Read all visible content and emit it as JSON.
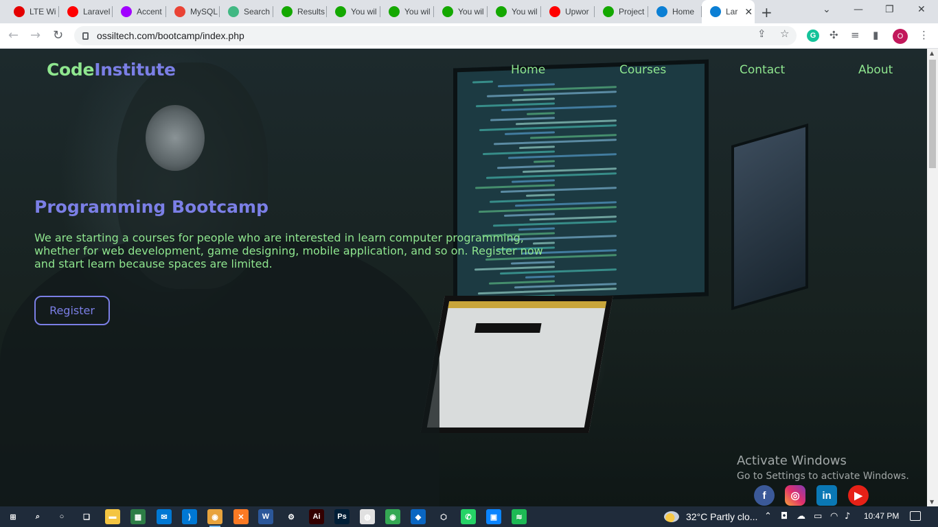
{
  "browser": {
    "tabs": [
      {
        "label": "LTE Wi",
        "favicon": "airtel",
        "color": "#e40000"
      },
      {
        "label": "Laravel",
        "favicon": "youtube",
        "color": "#ff0000"
      },
      {
        "label": "Accent",
        "favicon": "accenture",
        "color": "#a100ff"
      },
      {
        "label": "MySQL",
        "favicon": "gmail",
        "color": "#ea4335"
      },
      {
        "label": "Search",
        "favicon": "vue",
        "color": "#41b883"
      },
      {
        "label": "Results",
        "favicon": "upwork",
        "color": "#14a800"
      },
      {
        "label": "You wil",
        "favicon": "upwork",
        "color": "#14a800"
      },
      {
        "label": "You wil",
        "favicon": "upwork",
        "color": "#14a800"
      },
      {
        "label": "You wil",
        "favicon": "upwork",
        "color": "#14a800"
      },
      {
        "label": "You wil",
        "favicon": "upwork",
        "color": "#14a800"
      },
      {
        "label": "Upwor",
        "favicon": "youtube",
        "color": "#ff0000"
      },
      {
        "label": "Project",
        "favicon": "upwork",
        "color": "#14a800"
      },
      {
        "label": "Home",
        "favicon": "site",
        "color": "#0b7fd4"
      },
      {
        "label": "Lar",
        "favicon": "site",
        "color": "#0b7fd4",
        "active": true
      }
    ],
    "new_tab": "+",
    "window_controls": {
      "tab_search": "⌄",
      "minimize": "—",
      "restore": "❐",
      "close": "✕"
    },
    "url": "ossiltech.com/bootcamp/index.php",
    "profile_initial": "O",
    "grammarly_letter": "G"
  },
  "site": {
    "logo_code": "Code",
    "logo_institute": "Institute",
    "nav": [
      "Home",
      "Courses",
      "Contact",
      "About"
    ],
    "hero_title": "Programming Bootcamp",
    "hero_text": "We are starting a courses for people who are interested in learn computer programming, whether for web development, game designing, mobile application, and so on. Register now and start learn because spaces are limited.",
    "register_label": "Register",
    "social": [
      "facebook",
      "instagram",
      "linkedin",
      "youtube"
    ],
    "social_letters": {
      "facebook": "f",
      "instagram": "◎",
      "linkedin": "in",
      "youtube": "▶"
    }
  },
  "watermark": {
    "line1": "Activate Windows",
    "line2": "Go to Settings to activate Windows."
  },
  "taskbar": {
    "apps": [
      {
        "name": "windows-start",
        "glyph": "⊞",
        "color": "transparent"
      },
      {
        "name": "search",
        "glyph": "⌕",
        "color": "transparent"
      },
      {
        "name": "cortana",
        "glyph": "○",
        "color": "transparent"
      },
      {
        "name": "task-view",
        "glyph": "❏",
        "color": "transparent"
      },
      {
        "name": "file-explorer",
        "glyph": "▬",
        "color": "#f4c542"
      },
      {
        "name": "store",
        "glyph": "▦",
        "color": "#2d7d46"
      },
      {
        "name": "mail",
        "glyph": "✉",
        "color": "#0078d4"
      },
      {
        "name": "vscode",
        "glyph": "⟩",
        "color": "#0078d4"
      },
      {
        "name": "chrome",
        "glyph": "◉",
        "color": "#e8a33d"
      },
      {
        "name": "xampp",
        "glyph": "✕",
        "color": "#fb7a24"
      },
      {
        "name": "word",
        "glyph": "W",
        "color": "#2b579a"
      },
      {
        "name": "settings",
        "glyph": "⚙",
        "color": "transparent"
      },
      {
        "name": "illustrator",
        "glyph": "Ai",
        "color": "#330000"
      },
      {
        "name": "photoshop",
        "glyph": "Ps",
        "color": "#001e36"
      },
      {
        "name": "app-circle",
        "glyph": "◍",
        "color": "#e0e0e0"
      },
      {
        "name": "chrome-2",
        "glyph": "◉",
        "color": "#34a853"
      },
      {
        "name": "app-blue",
        "glyph": "◆",
        "color": "#0a66c2"
      },
      {
        "name": "package",
        "glyph": "⬡",
        "color": "transparent"
      },
      {
        "name": "whatsapp",
        "glyph": "✆",
        "color": "#25d366"
      },
      {
        "name": "app-window",
        "glyph": "▣",
        "color": "#0a84ff"
      },
      {
        "name": "spotify",
        "glyph": "≋",
        "color": "#1db954"
      }
    ],
    "weather_text": "32°C  Partly clo...",
    "clock": "10:47 PM"
  }
}
